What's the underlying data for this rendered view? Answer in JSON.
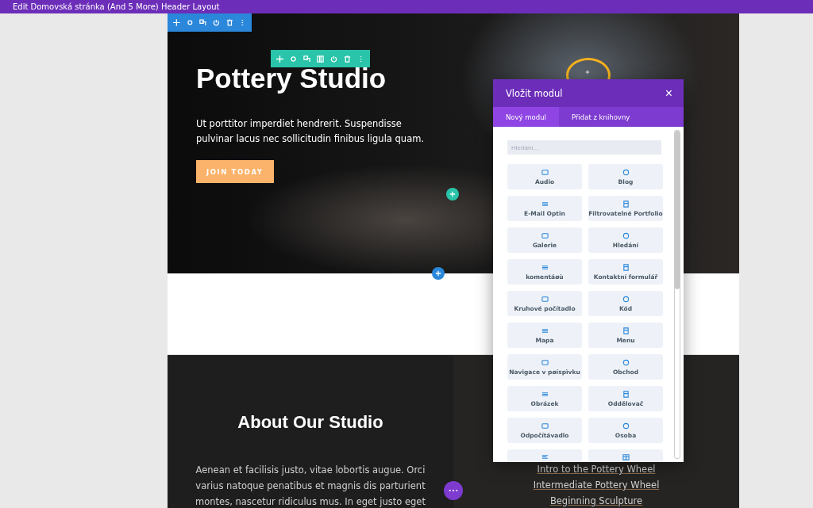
{
  "window": {
    "title": "Edit Domovská stránka (And 5 More) Header Layout"
  },
  "hero": {
    "title": "Pottery Studio",
    "text": "Ut porttitor imperdiet hendrerit. Suspendisse pulvinar lacus nec sollicitudin finibus ligula quam.",
    "button": "JOIN TODAY"
  },
  "about": {
    "title": "About Our Studio",
    "text": "Aenean et facilisis justo, vitae lobortis augue. Orci varius natoque penatibus et magnis dis parturient montes, nascetur ridiculus mus. In eget justo eget"
  },
  "classes": [
    "Intro to the Pottery Wheel",
    "Intermediate Pottery Wheel",
    "Beginning Sculpture"
  ],
  "modal": {
    "title": "Vložit modul",
    "close": "×",
    "tabs": [
      {
        "label": "Nový modul",
        "selected": true
      },
      {
        "label": "Přidat z knihovny",
        "selected": false
      }
    ],
    "search": {
      "placeholder": "Hledání..."
    },
    "modules": [
      "Audio",
      "Blog",
      "E-Mail Optin",
      "Filtrovatelné Portfolio",
      "Galerie",
      "Hledání",
      "komentáøù",
      "Kontaktní formulář",
      "Kruhové počítadlo",
      "Kód",
      "Mapa",
      "Menu",
      "Navigace v pøíspìvku",
      "Obchod",
      "Obrázek",
      "Oddělovač",
      "Odpočítávadlo",
      "Osoba"
    ]
  }
}
